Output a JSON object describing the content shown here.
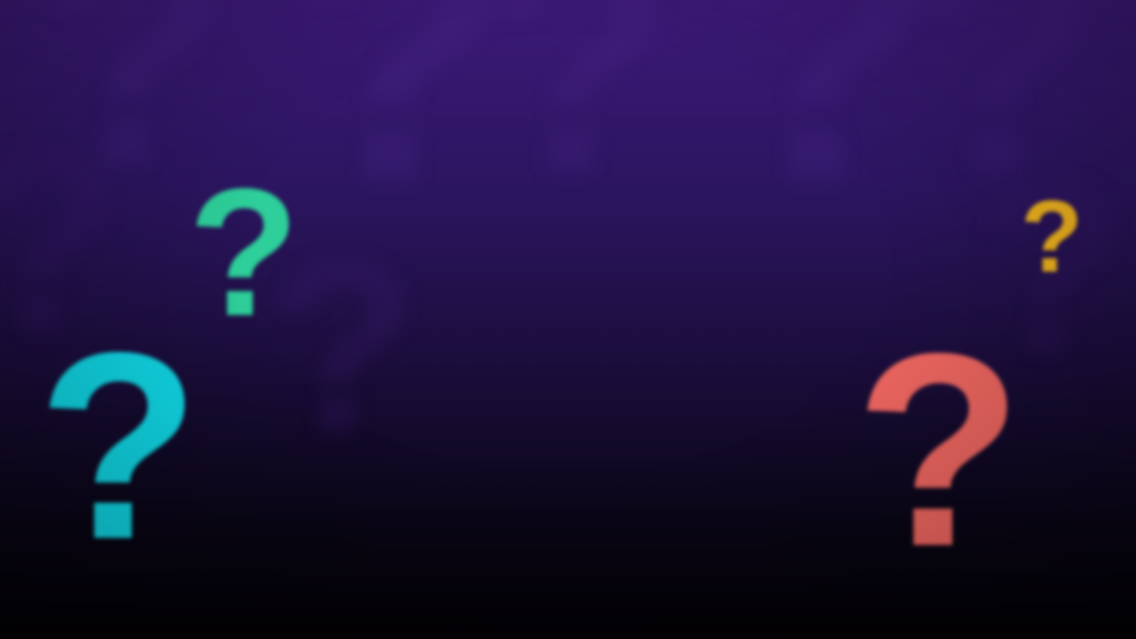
{
  "scene": {
    "background_top": "#3c1a78",
    "background_bottom": "#020104",
    "glyph": "?"
  },
  "background_marks": [
    {
      "glyph": "?",
      "color": "#4b2a8c"
    },
    {
      "glyph": "?",
      "color": "#4a2888"
    },
    {
      "glyph": "?",
      "color": "#482685"
    },
    {
      "glyph": "?",
      "color": "#4a2888"
    },
    {
      "glyph": "?",
      "color": "#452382"
    },
    {
      "glyph": "?",
      "color": "#3a1c6e"
    },
    {
      "glyph": "?",
      "color": "#3d1e72"
    },
    {
      "glyph": "?",
      "color": "#36196a"
    }
  ],
  "foreground_marks": {
    "cyan": {
      "glyph": "?",
      "color": "#11d8e6"
    },
    "green": {
      "glyph": "?",
      "color": "#2ecf9a"
    },
    "yellow": {
      "glyph": "?",
      "color": "#f2b51e"
    },
    "red": {
      "glyph": "?",
      "color": "#ee6660"
    }
  }
}
